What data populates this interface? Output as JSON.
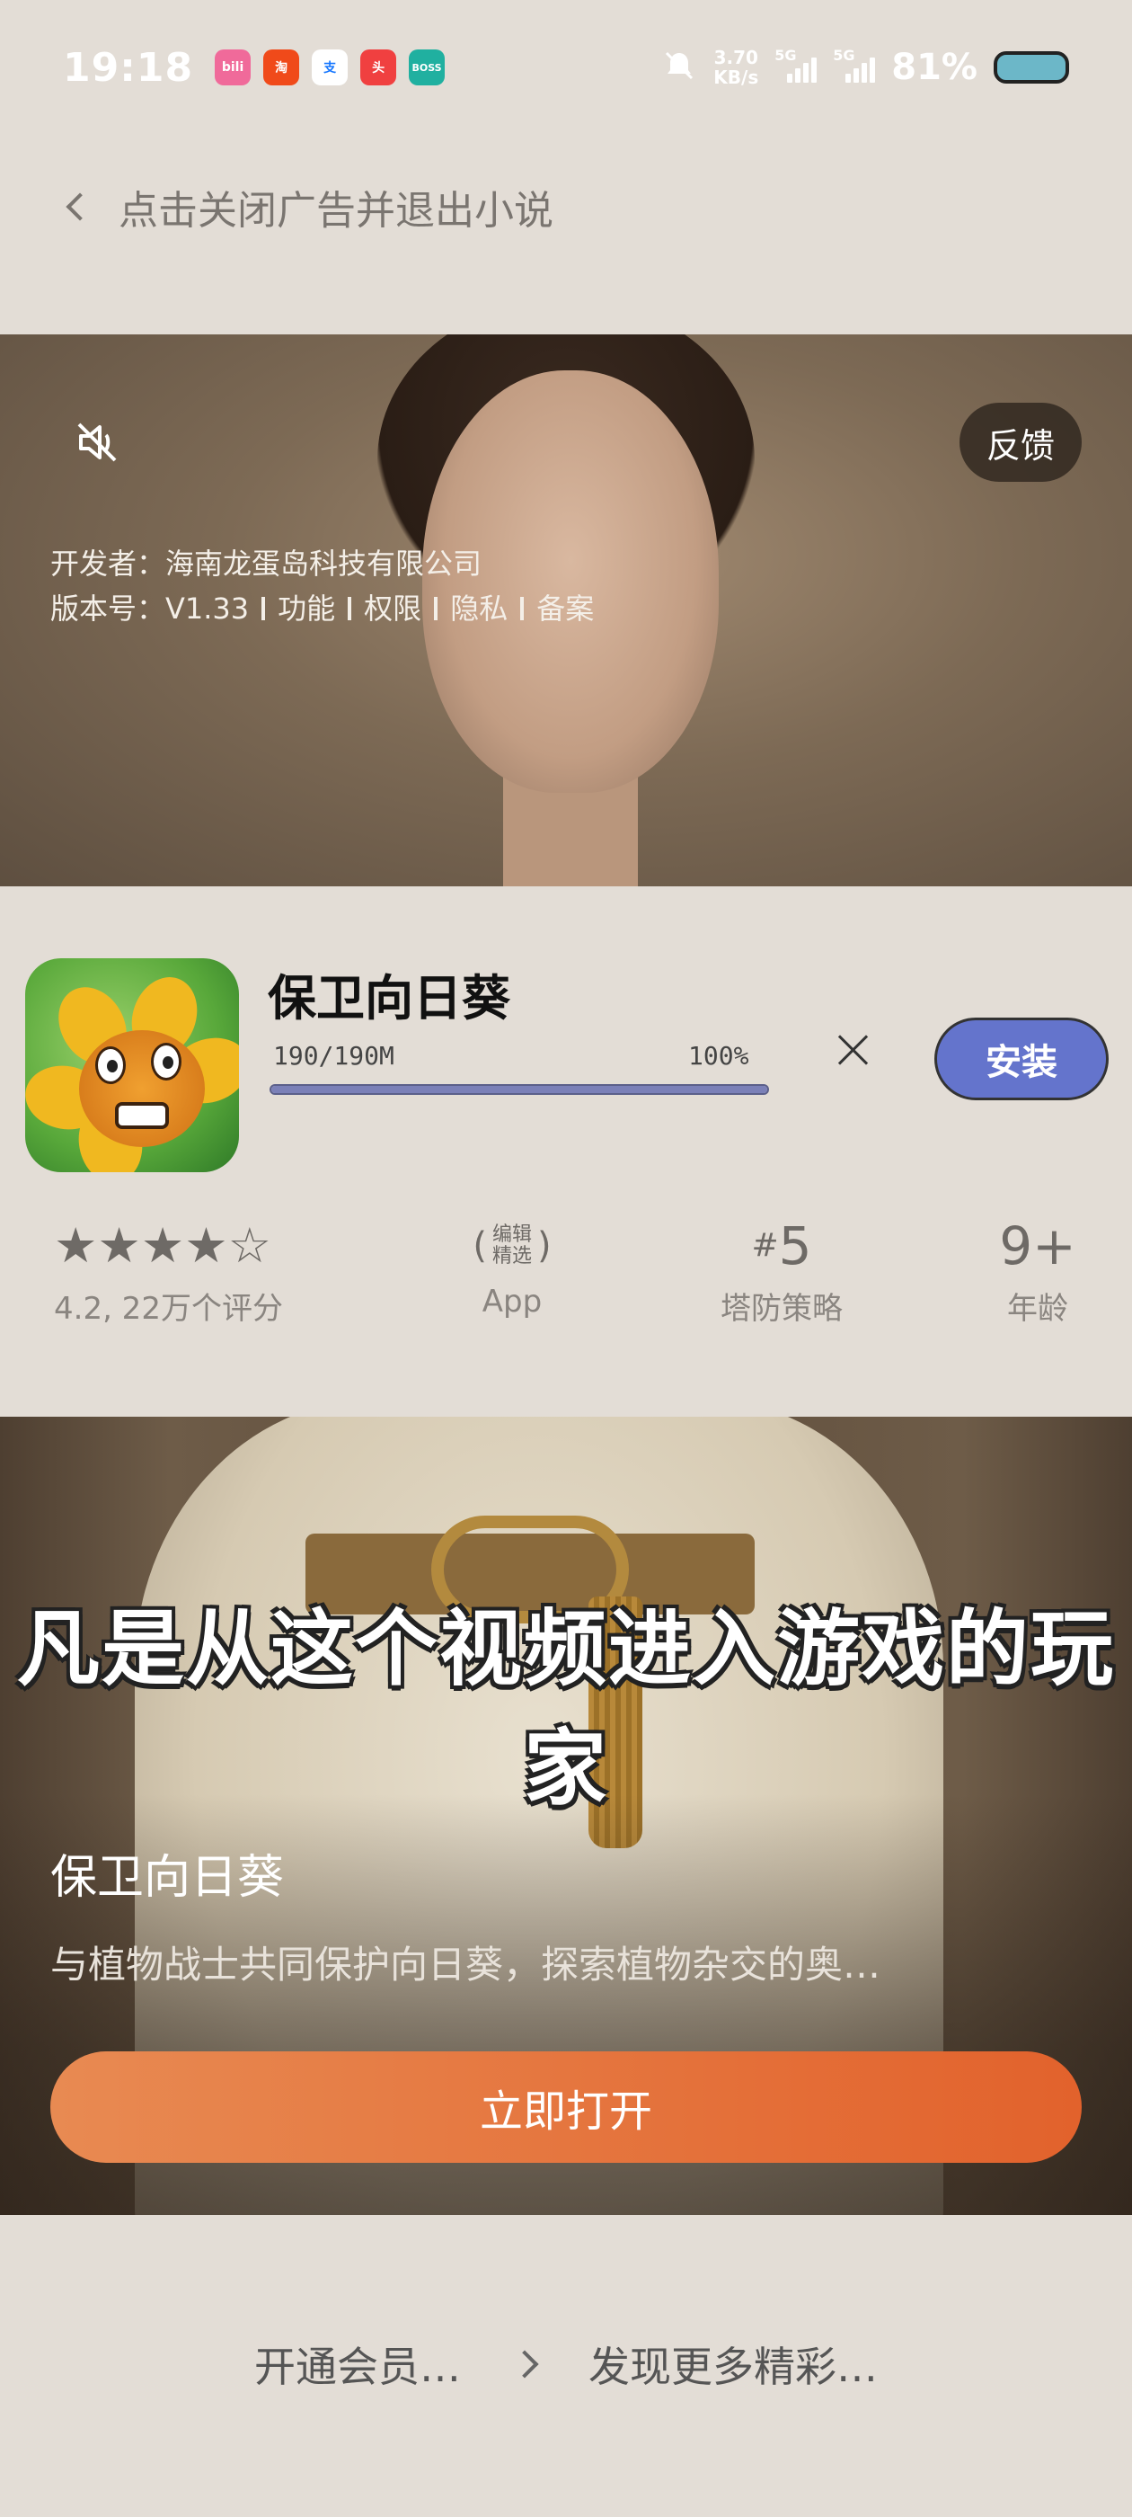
{
  "status_bar": {
    "time": "19:18",
    "apps": [
      {
        "name": "bilibili-app-icon",
        "label": "bili",
        "color": "#f06a9a"
      },
      {
        "name": "taobao-app-icon",
        "label": "淘",
        "color": "#f04a1a"
      },
      {
        "name": "alipay-app-icon",
        "label": "支",
        "color": "#ffffff"
      },
      {
        "name": "toutiao-app-icon",
        "label": "头",
        "color": "#f04040"
      },
      {
        "name": "boss-app-icon",
        "label": "BOSS",
        "color": "#20b0a0"
      }
    ],
    "net_speed_value": "3.70",
    "net_speed_unit": "KB/s",
    "signal_1_label": "5G",
    "signal_2_label": "5G",
    "battery_percent": "81%"
  },
  "back_bar": {
    "label": "点击关闭广告并退出小说"
  },
  "top_video": {
    "feedback_label": "反馈",
    "developer_line": "开发者：海南龙蛋岛科技有限公司",
    "version_label": "版本号：V1.33",
    "links": [
      "功能",
      "权限",
      "隐私",
      "备案"
    ]
  },
  "app_card": {
    "title": "保卫向日葵",
    "download_size": "190/190M",
    "download_percent": "100%",
    "progress_fraction": 1.0,
    "install_label": "安装",
    "rating_stars": "★★★★☆",
    "rating_text": "4.2, 22万个评分",
    "editor_line1": "编辑",
    "editor_line2": "精选",
    "editor_sub": "App",
    "rank_hash": "#",
    "rank_value": "5",
    "rank_sub": "塔防策略",
    "age_value": "9+",
    "age_sub": "年龄"
  },
  "bottom_video": {
    "caption": "凡是从这个视频进入游戏的玩家",
    "game_name": "保卫向日葵",
    "game_desc": "与植物战士共同保护向日葵，探索植物杂交的奥…",
    "open_label": "立即打开"
  },
  "footer": {
    "left_label": "开通会员…",
    "right_label": "发现更多精彩…"
  },
  "colors": {
    "install_button": "#6474cc",
    "open_button_start": "#e88a52",
    "open_button_end": "#e2622c",
    "background": "#e3ddd6"
  }
}
